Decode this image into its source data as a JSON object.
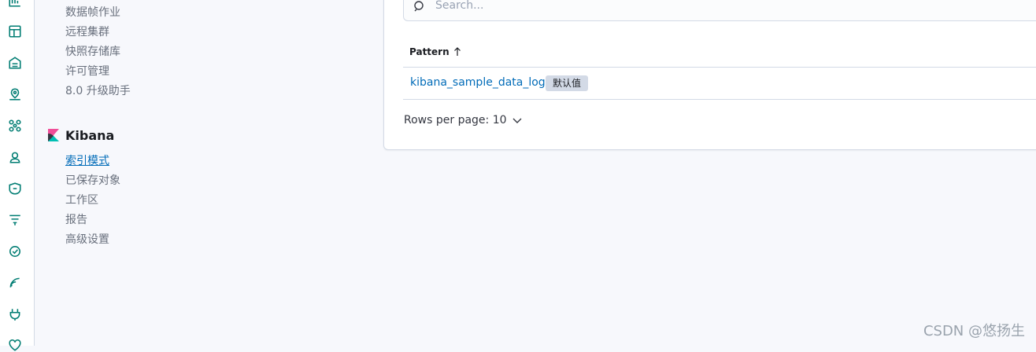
{
  "rail": {
    "icons": [
      "chart-icon",
      "dashboard-icon",
      "canvas-icon",
      "maps-icon",
      "ml-icon",
      "user-icon",
      "security-icon",
      "observability-icon",
      "uptime-icon",
      "apm-icon",
      "plug-icon",
      "heart-icon"
    ]
  },
  "nav": {
    "stack_items": [
      "数据帧作业",
      "远程集群",
      "快照存储库",
      "许可管理",
      "8.0 升级助手"
    ],
    "kibana_title": "Kibana",
    "kibana_items": [
      "索引模式",
      "已保存对象",
      "工作区",
      "报告",
      "高级设置"
    ]
  },
  "main": {
    "search_placeholder": "Search...",
    "table": {
      "column_header": "Pattern",
      "rows": [
        {
          "pattern": "kibana_sample_data_logs",
          "badge": "默认值"
        }
      ]
    },
    "pager_label": "Rows per page: 10"
  },
  "watermark": "CSDN @悠扬生",
  "colors": {
    "accent": "#006bb8",
    "rail_icon": "#017d73",
    "background": "#f7f8fc"
  }
}
